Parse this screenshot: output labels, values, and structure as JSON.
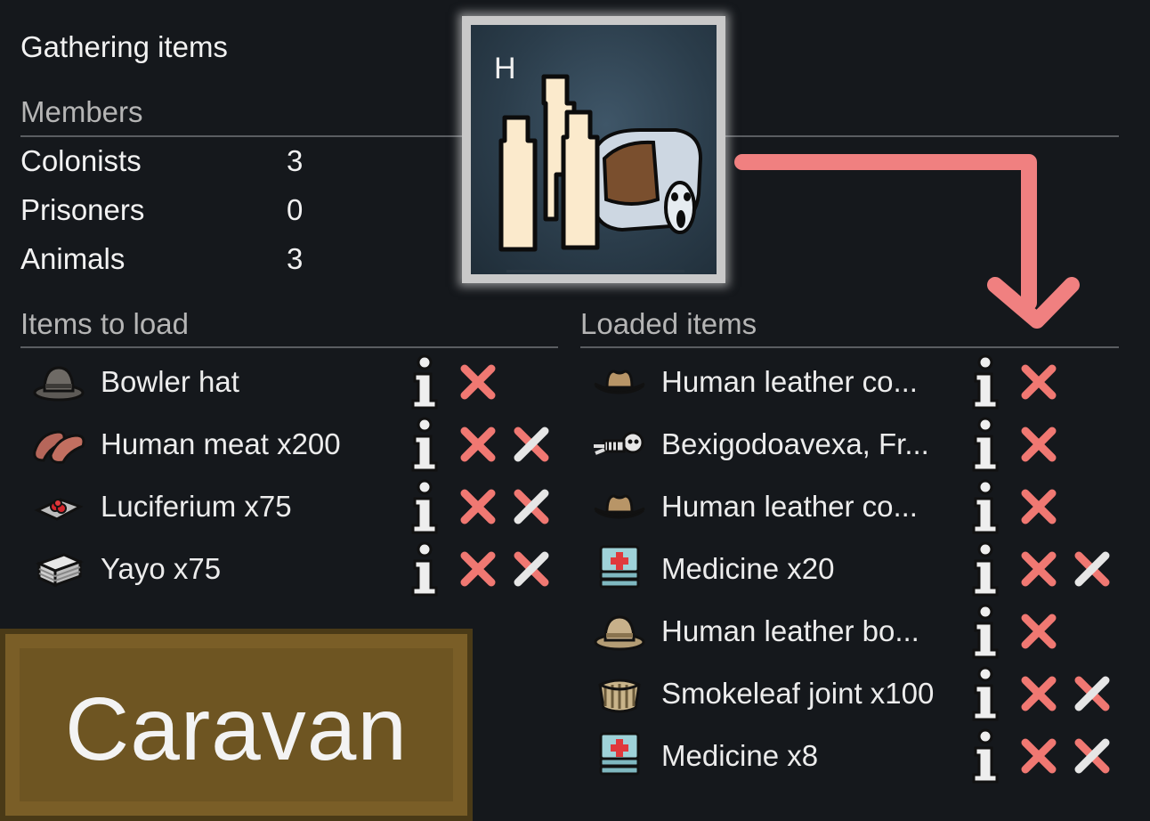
{
  "title": "Gathering items",
  "members": {
    "heading": "Members",
    "rows": [
      {
        "label": "Colonists",
        "value": "3"
      },
      {
        "label": "Prisoners",
        "value": "0"
      },
      {
        "label": "Animals",
        "value": "3"
      }
    ]
  },
  "portrait": {
    "hotkey": "H",
    "icon": "caravan-colonists-and-pack-animal-icon"
  },
  "items_to_load": {
    "heading": "Items to load",
    "items": [
      {
        "name": "Bowler hat",
        "icon": "bowler-hat-icon",
        "remove_all": false
      },
      {
        "name": "Human meat x200",
        "icon": "meat-icon",
        "remove_all": true
      },
      {
        "name": "Luciferium x75",
        "icon": "luciferium-icon",
        "remove_all": true
      },
      {
        "name": "Yayo x75",
        "icon": "yayo-icon",
        "remove_all": true
      }
    ]
  },
  "loaded_items": {
    "heading": "Loaded items",
    "items": [
      {
        "name": "Human leather co...",
        "icon": "cowboy-hat-icon",
        "remove_all": false
      },
      {
        "name": "Bexigodoavexa, Fr...",
        "icon": "corpse-skeleton-icon",
        "remove_all": false
      },
      {
        "name": "Human leather co...",
        "icon": "cowboy-hat-icon",
        "remove_all": false
      },
      {
        "name": "Medicine x20",
        "icon": "medicine-icon",
        "remove_all": true
      },
      {
        "name": "Human leather bo...",
        "icon": "bowler-hat-tan-icon",
        "remove_all": false
      },
      {
        "name": "Smokeleaf joint x100",
        "icon": "smokeleaf-joint-icon",
        "remove_all": true
      },
      {
        "name": "Medicine x8",
        "icon": "medicine-icon",
        "remove_all": true
      }
    ]
  },
  "caravan_button": {
    "label": "Caravan"
  },
  "colors": {
    "background": "#15181c",
    "remove_x": "#f07872",
    "arrow": "#f08080",
    "button": "#6e5522"
  }
}
